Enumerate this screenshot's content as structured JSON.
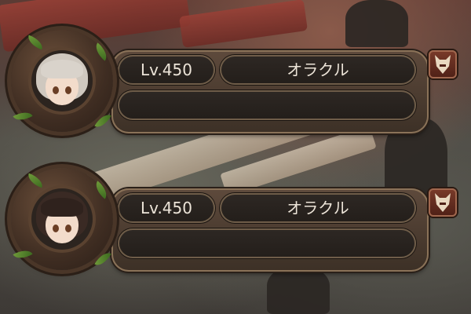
{
  "party": [
    {
      "level": "Lv.450",
      "name": "オラクル",
      "extra": "",
      "hair_color": "#cfc8bf",
      "badge_icon": "fox-mask-icon"
    },
    {
      "level": "Lv.450",
      "name": "オラクル",
      "extra": "",
      "hair_color": "#3a2a24",
      "badge_icon": "fox-mask-icon"
    }
  ],
  "colors": {
    "panel_border": "#8a7258",
    "pill_bg": "#231e1a",
    "text": "#ece4d8",
    "badge": "#7a3b2a"
  }
}
